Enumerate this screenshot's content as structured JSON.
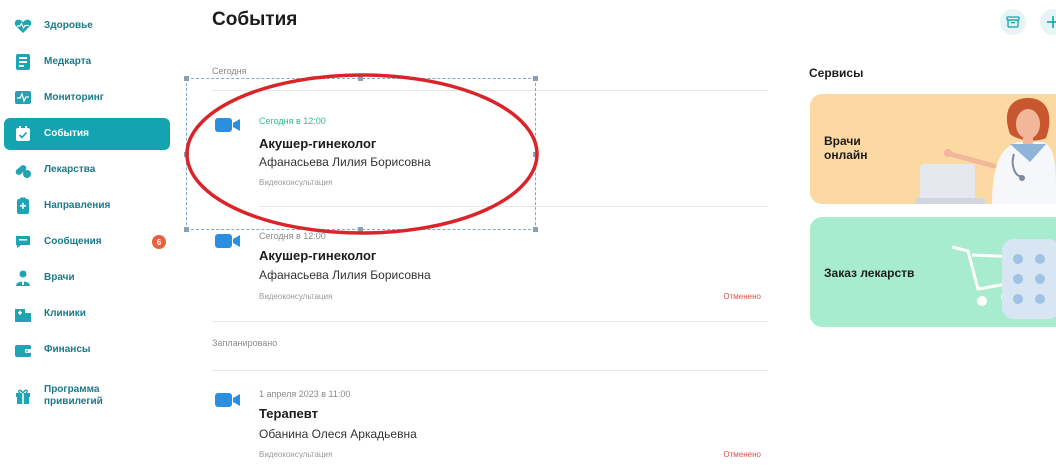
{
  "sidebar": {
    "items": [
      {
        "label": "Здоровье",
        "icon": "heart-icon"
      },
      {
        "label": "Медкарта",
        "icon": "medical-card-icon"
      },
      {
        "label": "Мониторинг",
        "icon": "monitoring-icon"
      },
      {
        "label": "События",
        "icon": "calendar-icon",
        "active": true
      },
      {
        "label": "Лекарства",
        "icon": "pills-icon"
      },
      {
        "label": "Направления",
        "icon": "referral-icon"
      },
      {
        "label": "Сообщения",
        "icon": "chat-icon",
        "badge": "6"
      },
      {
        "label": "Врачи",
        "icon": "doctor-icon"
      },
      {
        "label": "Клиники",
        "icon": "clinic-icon"
      },
      {
        "label": "Финансы",
        "icon": "wallet-icon"
      },
      {
        "label": "Программа привилегий",
        "icon": "gift-icon"
      }
    ]
  },
  "header": {
    "title": "События",
    "actions": [
      "archive-icon",
      "plus-icon"
    ]
  },
  "events": {
    "sections": [
      {
        "label": "Сегодня",
        "items": [
          {
            "when": "Сегодня в 12:00",
            "specialty": "Акушер-гинеколог",
            "doctor": "Афанасьева Лилия Борисовна",
            "kind": "Видеоконсультация",
            "status": ""
          },
          {
            "when": "Сегодня в 12:00",
            "specialty": "Акушер-гинеколог",
            "doctor": "Афанасьева Лилия Борисовна",
            "kind": "Видеоконсультация",
            "status": "Отменено"
          }
        ]
      },
      {
        "label": "Запланировано",
        "items": [
          {
            "when": "1 апреля 2023 в 11:00",
            "specialty": "Терапевт",
            "doctor": "Обанина Олеся Аркадьевна",
            "kind": "Видеоконсультация",
            "status": "Отменено"
          }
        ]
      }
    ]
  },
  "services": {
    "title": "Сервисы",
    "cards": [
      {
        "label": "Врачи онлайн",
        "color": "#fcd9a2"
      },
      {
        "label": "Заказ лекарств",
        "color": "#a8ecd0"
      }
    ]
  },
  "colors": {
    "accent": "#13a3b1",
    "today": "#2fbf8a",
    "cancelled": "#e0504a",
    "annotation": "#d9242a",
    "badge": "#e8603c"
  }
}
